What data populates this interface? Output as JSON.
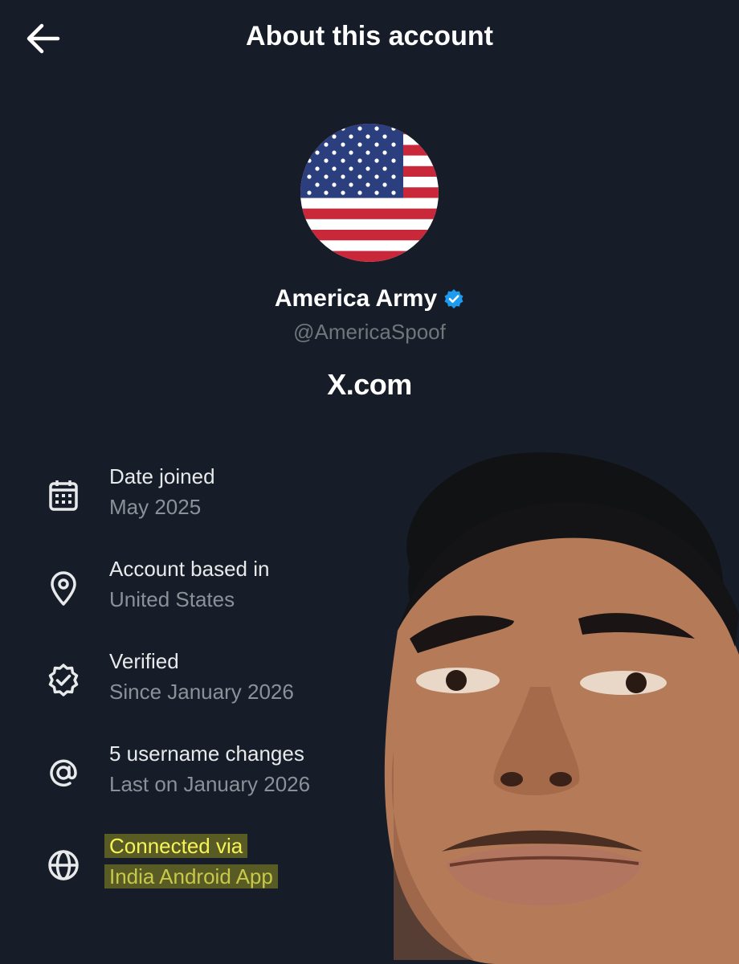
{
  "header": {
    "title": "About this account",
    "back_icon": "arrow-left-icon"
  },
  "profile": {
    "display_name": "America Army",
    "handle": "@AmericaSpoof",
    "verified_icon": "verified-badge-icon",
    "avatar_description": "US flag"
  },
  "brand": {
    "text": "X.com",
    "logo_icon": "x-logo-icon"
  },
  "details": [
    {
      "icon": "calendar-icon",
      "label": "Date joined",
      "value": "May 2025",
      "highlighted": false
    },
    {
      "icon": "location-pin-icon",
      "label": "Account based in",
      "value": "United States",
      "highlighted": false
    },
    {
      "icon": "verified-check-icon",
      "label": "Verified",
      "value": "Since January 2026",
      "highlighted": false
    },
    {
      "icon": "at-sign-icon",
      "label": "5 username changes",
      "value": "Last on January 2026",
      "highlighted": false
    },
    {
      "icon": "globe-icon",
      "label": "Connected via",
      "value": "India Android App",
      "highlighted": true
    }
  ],
  "colors": {
    "background": "#161d28",
    "text_primary": "#ffffff",
    "text_secondary": "#71767b",
    "verified_blue": "#1d9bf0",
    "highlight": "#f4ec1e"
  }
}
